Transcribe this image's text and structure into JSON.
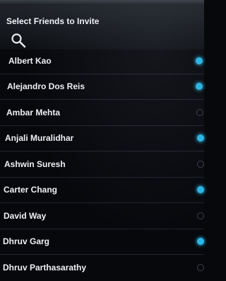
{
  "header": {
    "title": "Select Friends to Invite",
    "search_icon": "search-icon"
  },
  "colors": {
    "accent": "#29b8e8",
    "background": "#07080c"
  },
  "friends": [
    {
      "name": "Albert Kao",
      "selected": true
    },
    {
      "name": "Alejandro Dos Reis",
      "selected": true
    },
    {
      "name": "Ambar Mehta",
      "selected": false
    },
    {
      "name": "Anjali Muralidhar",
      "selected": true
    },
    {
      "name": "Ashwin Suresh",
      "selected": false
    },
    {
      "name": "Carter Chang",
      "selected": true
    },
    {
      "name": "David Way",
      "selected": false
    },
    {
      "name": "Dhruv Garg",
      "selected": true
    },
    {
      "name": "Dhruv Parthasarathy",
      "selected": false
    }
  ]
}
